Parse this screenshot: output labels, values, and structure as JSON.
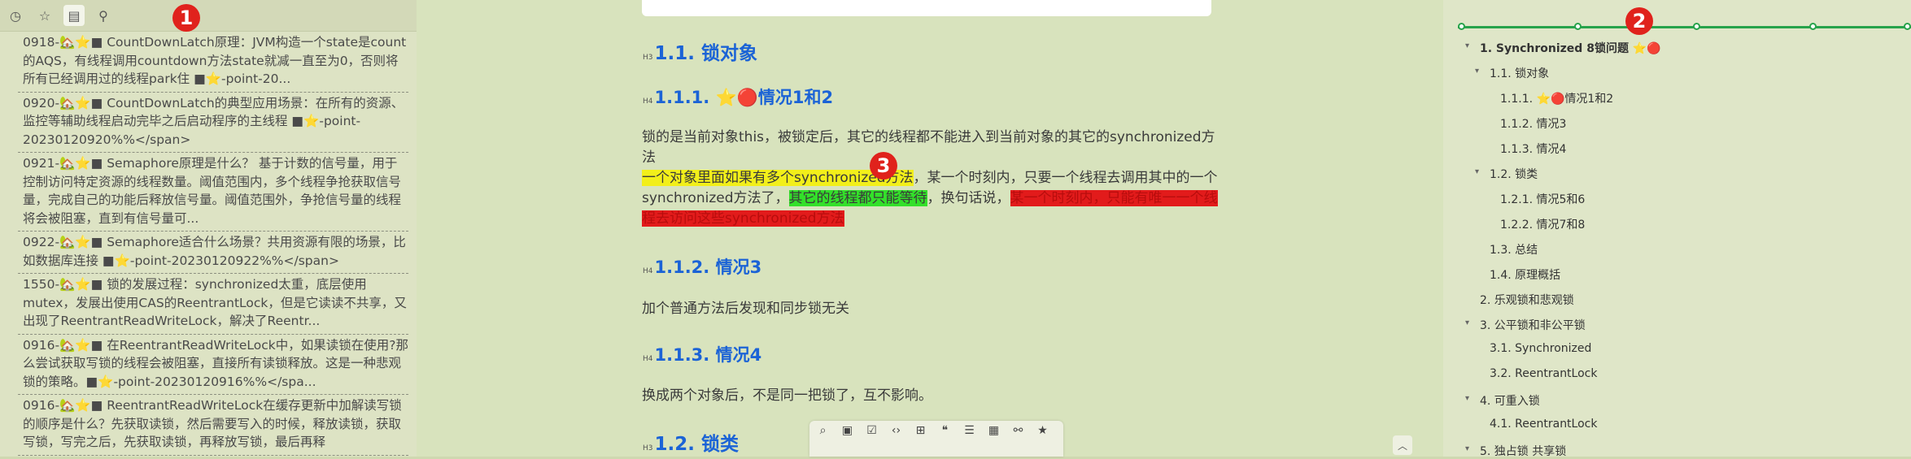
{
  "badges": [
    "1",
    "2",
    "3"
  ],
  "left_toolbar": {
    "icons": [
      "clock-icon",
      "star-icon",
      "document-icon",
      "pin-icon"
    ]
  },
  "notes": [
    "0918-🏡⭐■ CountDownLatch原理：JVM构造一个state是count的AQS，有线程调用countdown方法state就减一直至为0，否则将所有已经调用过的线程park住 ■⭐-point-20...",
    "0920-🏡⭐■ CountDownLatch的典型应用场景：在所有的资源、监控等辅助线程启动完毕之后启动程序的主线程 ■⭐-point-20230120920%%</span>",
    "0921-🏡⭐■ Semaphore原理是什么？ 基于计数的信号量，用于控制访问特定资源的线程数量。阈值范围内，多个线程争抢获取信号量，完成自己的功能后释放信号量。阈值范围外，争抢信号量的线程将会被阻塞，直到有信号量可...",
    "0922-🏡⭐■ Semaphore适合什么场景？共用资源有限的场景，比如数据库连接 ■⭐-point-20230120922%%</span>",
    "1550-🏡⭐■ 锁的发展过程：synchronized太重，底层使用mutex，发展出使用CAS的ReentrantLock，但是它读读不共享，又出现了ReentrantReadWriteLock，解决了Reentr...",
    "0916-🏡⭐■ 在ReentrantReadWriteLock中，如果读锁在使用?那么尝试获取写锁的线程会被阻塞，直接所有读锁释放。这是一种悲观锁的策略。■⭐-point-20230120916%%</spa...",
    "0916-🏡⭐■ ReentrantReadWriteLock在缓存更新中加解读写锁的顺序是什么？先获取读锁，然后需要写入的时候，释放读锁，获取写锁，写完之后，先获取读锁，再释放写锁，最后再释"
  ],
  "editor": {
    "h1": "1.1. 锁对象",
    "h2": "1.1.1. ⭐🔴情况1和2",
    "p1": "锁的是当前对象this，被锁定后，其它的线程都不能进入到当前对象的其它的synchronized方法",
    "p2_yellow": "一个对象里面如果有多个synchronized方法",
    "p2_a": "，某一个时刻内，只要一个线程去调用其中的一个synchronized方法了，",
    "p2_green": "其它的线程都只能等待",
    "p2_b": "，换句话说，",
    "p2_red": "某一个时刻内，只能有唯一一个线程去访问这些synchronized方法",
    "h3": "1.1.2. 情况3",
    "p3": "加个普通方法后发现和同步锁无关",
    "h4": "1.1.3. 情况4",
    "p4": "换成两个对象后，不是同一把锁了，互不影响。",
    "h5": "1.2. 锁类",
    "h_prefix_h3": "H3",
    "h_prefix_h4": "H4"
  },
  "float_toolbar_icons": [
    "search-icon",
    "image-icon",
    "checkbox-icon",
    "code-icon",
    "code-block-icon",
    "quote-icon",
    "list-icon",
    "table-icon",
    "link-icon",
    "star-icon"
  ],
  "outline": {
    "progress": 0.26,
    "items": [
      {
        "label": "1. Synchronized 8锁问题 ⭐🔴",
        "level": 1,
        "expanded": true
      },
      {
        "label": "1.1. 锁对象",
        "level": 2,
        "expanded": true
      },
      {
        "label": "1.1.1. ⭐🔴情况1和2",
        "level": 3
      },
      {
        "label": "1.1.2. 情况3",
        "level": 3
      },
      {
        "label": "1.1.3. 情况4",
        "level": 3
      },
      {
        "label": "1.2. 锁类",
        "level": 2,
        "expanded": true
      },
      {
        "label": "1.2.1. 情况5和6",
        "level": 3
      },
      {
        "label": "1.2.2. 情况7和8",
        "level": 3
      },
      {
        "label": "1.3. 总结",
        "level": 2
      },
      {
        "label": "1.4. 原理概括",
        "level": 2
      },
      {
        "label": "2. 乐观锁和悲观锁",
        "level": 1
      },
      {
        "label": "3. 公平锁和非公平锁",
        "level": 1,
        "expanded": true
      },
      {
        "label": "3.1. Synchronized",
        "level": 2
      },
      {
        "label": "3.2. ReentrantLock",
        "level": 2
      },
      {
        "label": "4. 可重入锁",
        "level": 1,
        "expanded": true
      },
      {
        "label": "4.1. ReentrantLock",
        "level": 2
      },
      {
        "label": "5. 独占锁 共享锁",
        "level": 1,
        "expanded": true
      }
    ]
  },
  "colors": {
    "accent": "#1b63d6",
    "progress": "#27a34b",
    "badge": "#e0221c",
    "highlight_yellow": "#f2ef1a",
    "highlight_green": "#33e02a",
    "highlight_red": "#e21b1b"
  }
}
